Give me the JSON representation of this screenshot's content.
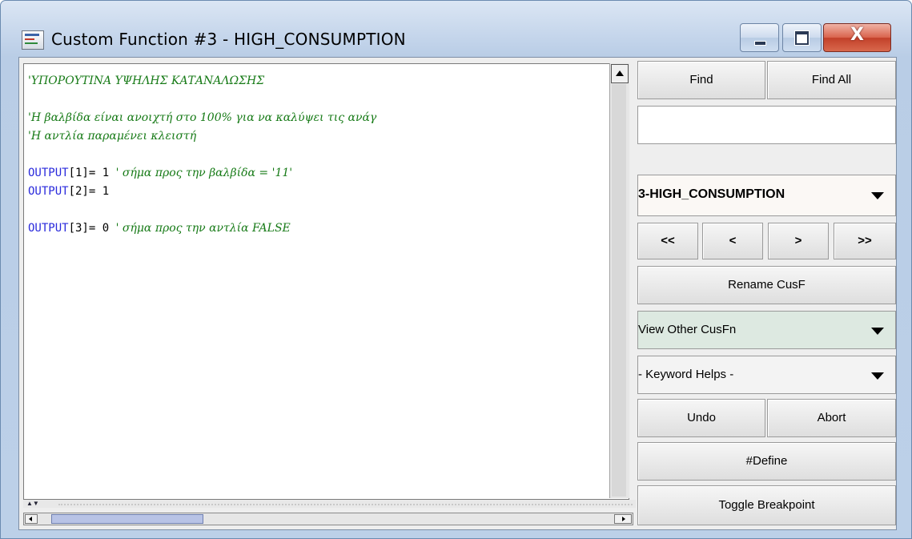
{
  "window": {
    "title": "Custom Function #3 - HIGH_CONSUMPTION",
    "controls": {
      "minimize": "minimize",
      "maximize": "maximize",
      "close": "X"
    }
  },
  "editor": {
    "lines": [
      [
        {
          "t": "'ΥΠΟΡΟΥΤΙΝΑ ΥΨΗΛΗΣ ΚΑΤΑΝΑΛΩΣΗΣ",
          "c": "comment"
        }
      ],
      [],
      [
        {
          "t": "'Η βαλβίδα είναι ανοιχτή στο 100% για να καλύψει τις ανάγ",
          "c": "comment"
        }
      ],
      [
        {
          "t": "'Η αντλία παραμένει κλειστή",
          "c": "comment"
        }
      ],
      [],
      [
        {
          "t": "OUTPUT",
          "c": "kw"
        },
        {
          "t": "[1]= 1 ",
          "c": "plain"
        },
        {
          "t": "' σήμα προς την βαλβίδα = '11'",
          "c": "comment"
        }
      ],
      [
        {
          "t": "OUTPUT",
          "c": "kw"
        },
        {
          "t": "[2]= 1",
          "c": "plain"
        }
      ],
      [],
      [
        {
          "t": "OUTPUT",
          "c": "kw"
        },
        {
          "t": "[3]= 0 ",
          "c": "plain"
        },
        {
          "t": "' σήμα προς την αντλία FALSE",
          "c": "comment"
        }
      ]
    ]
  },
  "panel": {
    "find_label": "Find",
    "find_all_label": "Find All",
    "search_value": "",
    "function_select_value": "3-HIGH_CONSUMPTION",
    "nav_first": "<<",
    "nav_prev": "<",
    "nav_next": ">",
    "nav_last": ">>",
    "rename_label": "Rename CusF",
    "view_other_value": "View Other CusFn",
    "keyword_helps_value": "- Keyword Helps -",
    "undo_label": "Undo",
    "abort_label": "Abort",
    "define_label": "#Define",
    "toggle_breakpoint_label": "Toggle Breakpoint"
  },
  "colors": {
    "comment": "#167a16",
    "keyword": "#2a2adc",
    "view_other_bg": "#dde9e1",
    "select_bg": "#fbf8f5"
  }
}
